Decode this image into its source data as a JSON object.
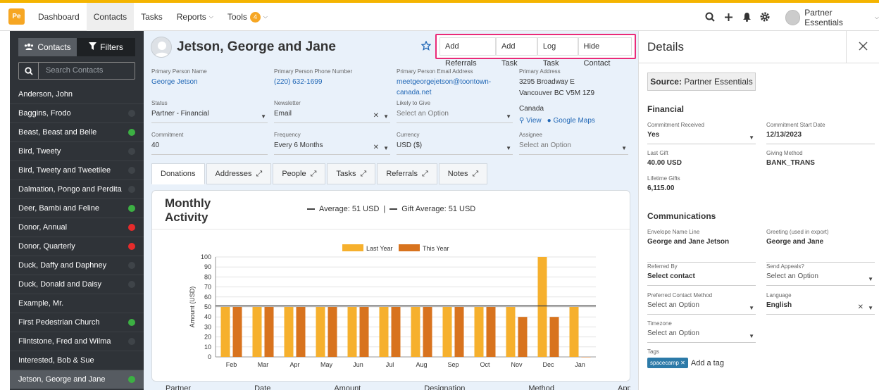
{
  "app": {
    "logo": "Pe"
  },
  "nav": {
    "items": [
      {
        "label": "Dashboard"
      },
      {
        "label": "Contacts"
      },
      {
        "label": "Tasks"
      },
      {
        "label": "Reports"
      },
      {
        "label": "Tools",
        "badge": "4"
      }
    ]
  },
  "user": {
    "name": "Partner Essentials"
  },
  "sidebar": {
    "tab_contacts": "Contacts",
    "tab_filters": "Filters",
    "search_placeholder": "Search Contacts",
    "contacts": [
      {
        "name": "Anderson, John",
        "status": "none"
      },
      {
        "name": "Baggins, Frodo",
        "status": "gray"
      },
      {
        "name": "Beast, Beast and Belle",
        "status": "green"
      },
      {
        "name": "Bird, Tweety",
        "status": "gray"
      },
      {
        "name": "Bird, Tweety and Tweetilee",
        "status": "gray"
      },
      {
        "name": "Dalmation, Pongo and Perdita",
        "status": "gray"
      },
      {
        "name": "Deer, Bambi and Feline",
        "status": "green"
      },
      {
        "name": "Donor, Annual",
        "status": "red"
      },
      {
        "name": "Donor, Quarterly",
        "status": "red"
      },
      {
        "name": "Duck, Daffy and Daphney",
        "status": "gray"
      },
      {
        "name": "Duck, Donald and Daisy",
        "status": "gray"
      },
      {
        "name": "Example, Mr.",
        "status": "none"
      },
      {
        "name": "First Pedestrian Church",
        "status": "green"
      },
      {
        "name": "Flintstone, Fred and Wilma",
        "status": "gray"
      },
      {
        "name": "Interested, Bob & Sue",
        "status": "none"
      },
      {
        "name": "Jetson, George and Jane",
        "status": "green"
      }
    ],
    "status_colors": {
      "green": "#3cb043",
      "red": "#e62b2b",
      "gray": "#3f4449"
    }
  },
  "contact": {
    "name": "Jetson, George and Jane",
    "actions": [
      "Add Referrals",
      "Add Task",
      "Log Task",
      "Hide Contact"
    ],
    "fields": {
      "primary_name_label": "Primary Person Name",
      "primary_name": "George Jetson",
      "phone_label": "Primary Person Phone Number",
      "phone": "(220) 632-1699",
      "email_label": "Primary Person Email Address",
      "email_line1": "meetgeorgejetson@toontown-",
      "email_line2": "canada.net",
      "address_label": "Primary Address",
      "address_line1": "3295 Broadway E",
      "address_line2": "Vancouver BC V5M 1Z9",
      "address_line3": "Canada",
      "view_link": "View",
      "maps_link": "Google Maps",
      "status_label": "Status",
      "status": "Partner - Financial",
      "newsletter_label": "Newsletter",
      "newsletter": "Email",
      "likely_label": "Likely to Give",
      "likely": "Select an Option",
      "commitment_label": "Commitment",
      "commitment": "40",
      "frequency_label": "Frequency",
      "frequency": "Every 6 Months",
      "currency_label": "Currency",
      "currency": "USD ($)",
      "assignee_label": "Assignee",
      "assignee": "Select an Option"
    },
    "tabs": [
      "Donations",
      "Addresses",
      "People",
      "Tasks",
      "Referrals",
      "Notes"
    ]
  },
  "activity": {
    "title": "Monthly Activity",
    "average": "Average: 51 USD",
    "gift_average": "Gift Average: 51 USD",
    "separator": "|",
    "bottom_headers": [
      "Partner Name",
      "Date",
      "Amount",
      "Designation",
      "Method",
      "Appeal"
    ]
  },
  "chart_data": {
    "type": "bar",
    "categories": [
      "Feb",
      "Mar",
      "Apr",
      "May",
      "Jun",
      "Jul",
      "Aug",
      "Sep",
      "Oct",
      "Nov",
      "Dec",
      "Jan"
    ],
    "series": [
      {
        "name": "Last Year",
        "color": "#f6b02d",
        "values": [
          50,
          50,
          50,
          50,
          50,
          50,
          50,
          50,
          50,
          50,
          100,
          50
        ]
      },
      {
        "name": "This Year",
        "color": "#d8731e",
        "values": [
          50,
          50,
          50,
          50,
          50,
          50,
          50,
          50,
          50,
          40,
          40,
          0
        ]
      }
    ],
    "average_line": 51,
    "ylabel": "Amount (USD)",
    "xlabel": "",
    "ylim": [
      0,
      100
    ],
    "yticks": [
      0,
      10,
      20,
      30,
      40,
      50,
      60,
      70,
      80,
      90,
      100
    ],
    "grid": true,
    "legend": "top-center"
  },
  "details": {
    "title": "Details",
    "source_label": "Source:",
    "source_value": "Partner Essentials",
    "financial_title": "Financial",
    "commitment_received_label": "Commitment Received",
    "commitment_received": "Yes",
    "commitment_start_label": "Commitment Start Date",
    "commitment_start": "12/13/2023",
    "last_gift_label": "Last Gift",
    "last_gift": "40.00 USD",
    "giving_method_label": "Giving Method",
    "giving_method": "BANK_TRANS",
    "lifetime_label": "Lifetime Gifts",
    "lifetime": "6,115.00",
    "communications_title": "Communications",
    "envelope_label": "Envelope Name Line",
    "envelope": "George and Jane Jetson",
    "greeting_label": "Greeting (used in export)",
    "greeting": "George and Jane",
    "referred_label": "Referred By",
    "referred": "Select contact",
    "appeals_label": "Send Appeals?",
    "appeals": "Select an Option",
    "contact_method_label": "Preferred Contact Method",
    "contact_method": "Select an Option",
    "language_label": "Language",
    "language": "English",
    "timezone_label": "Timezone",
    "timezone": "Select an Option",
    "tags_label": "Tags",
    "tag": "spacecamp",
    "add_tag": "Add a tag"
  }
}
